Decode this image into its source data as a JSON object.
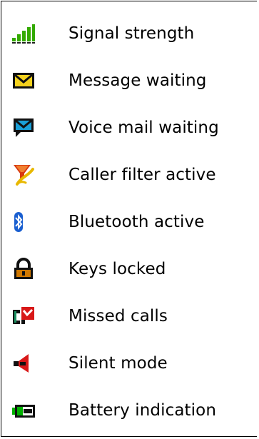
{
  "legend": {
    "items": [
      {
        "icon": "signal-strength-icon",
        "label": "Signal strength"
      },
      {
        "icon": "message-waiting-icon",
        "label": "Message waiting"
      },
      {
        "icon": "voice-mail-waiting-icon",
        "label": "Voice mail waiting"
      },
      {
        "icon": "caller-filter-icon",
        "label": "Caller filter active"
      },
      {
        "icon": "bluetooth-icon",
        "label": "Bluetooth active"
      },
      {
        "icon": "keys-locked-icon",
        "label": "Keys locked"
      },
      {
        "icon": "missed-calls-icon",
        "label": "Missed calls"
      },
      {
        "icon": "silent-mode-icon",
        "label": "Silent mode"
      },
      {
        "icon": "battery-icon",
        "label": "Battery indication"
      }
    ]
  },
  "colors": {
    "signal": "#33aa00",
    "signal_dim": "#222222",
    "envelope": "#f5d21e",
    "voicemail": "#1aa0d8",
    "caller_filter": "#e8b800",
    "bluetooth": "#1a5fd0",
    "lock": "#d07800",
    "missed": "#d81818",
    "battery": "#00b000"
  }
}
